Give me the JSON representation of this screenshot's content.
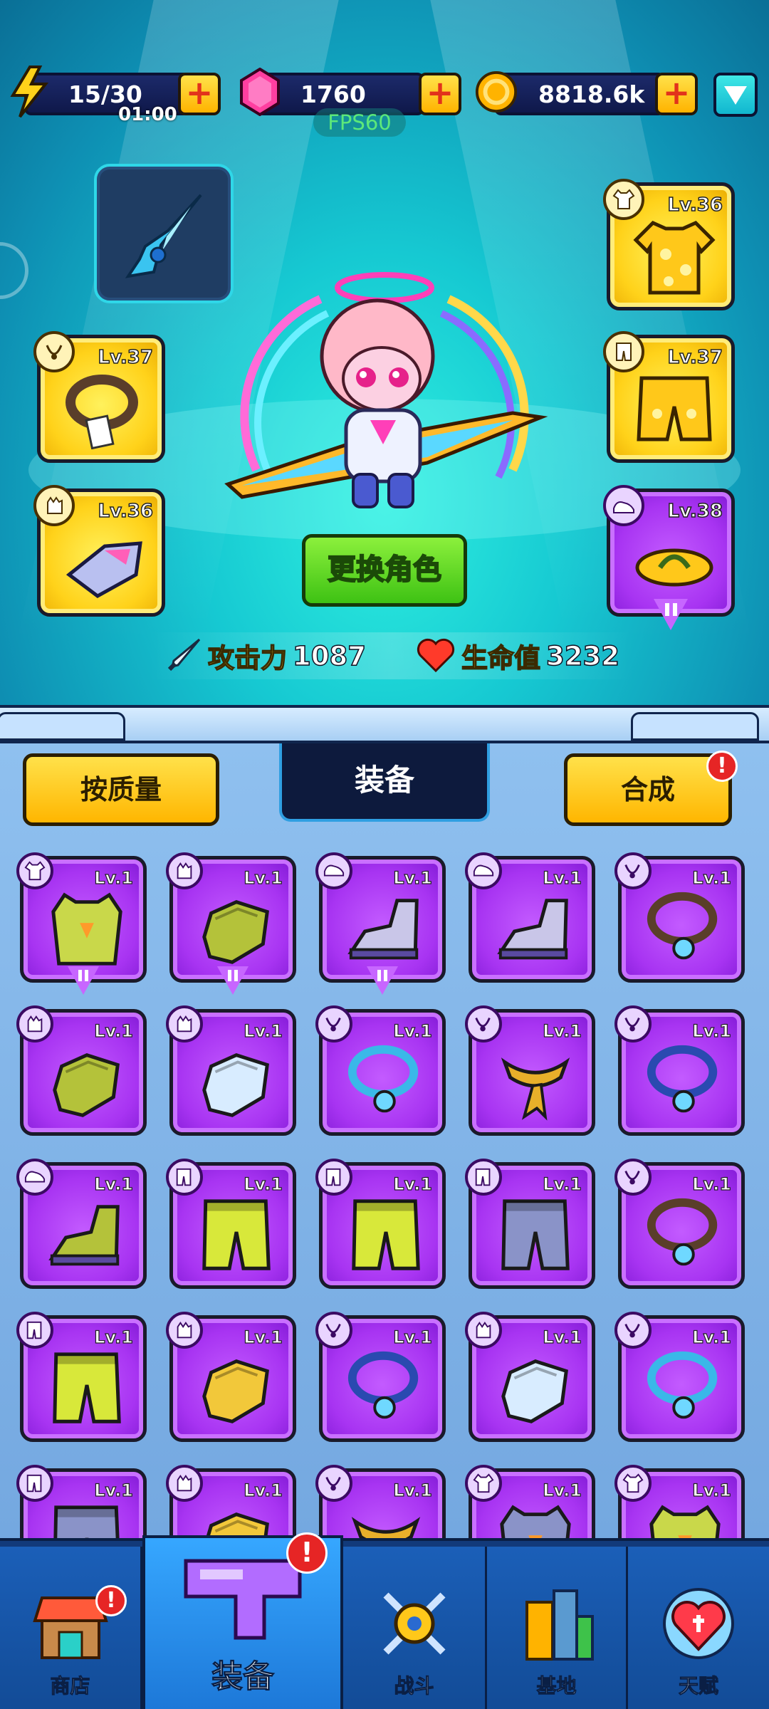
{
  "resources": {
    "energy": {
      "value": "15/30",
      "timer": "01:00"
    },
    "gems": {
      "value": "1760"
    },
    "coins": {
      "value": "8818.6k"
    }
  },
  "fps": "FPS60",
  "equipped": {
    "top": {
      "level": "Lv.36",
      "slot": "shirt-icon"
    },
    "left_mid": {
      "level": "Lv.37",
      "slot": "necklace-icon"
    },
    "right_mid": {
      "level": "Lv.37",
      "slot": "pants-icon"
    },
    "left_bottom": {
      "level": "Lv.36",
      "slot": "glove-icon"
    },
    "right_bottom": {
      "level": "Lv.38",
      "slot": "shoe-icon"
    }
  },
  "change_character_label": "更换角色",
  "stats": {
    "attack_label": "攻击力",
    "attack_value": "1087",
    "hp_label": "生命值",
    "hp_value": "3232"
  },
  "inventory": {
    "sort_label": "按质量",
    "tab_label": "装备",
    "merge_label": "合成",
    "merge_alert": "!",
    "items": [
      {
        "level": "Lv.1",
        "slot": "vest",
        "color": "#c9d84a",
        "merge": true
      },
      {
        "level": "Lv.1",
        "slot": "glove",
        "color": "#b4c23a",
        "merge": true
      },
      {
        "level": "Lv.1",
        "slot": "boot",
        "color": "#c9c6e8",
        "merge": true
      },
      {
        "level": "Lv.1",
        "slot": "boot",
        "color": "#c9c6e8",
        "merge": false
      },
      {
        "level": "Lv.1",
        "slot": "necklace",
        "color": "#5a3e2a",
        "merge": false
      },
      {
        "level": "Lv.1",
        "slot": "glove",
        "color": "#b4c23a",
        "merge": false
      },
      {
        "level": "Lv.1",
        "slot": "glove",
        "color": "#d8ecff",
        "merge": false
      },
      {
        "level": "Lv.1",
        "slot": "necklace",
        "color": "#3ab8e8",
        "merge": false
      },
      {
        "level": "Lv.1",
        "slot": "scarf",
        "color": "#e8b02a",
        "merge": false
      },
      {
        "level": "Lv.1",
        "slot": "necklace",
        "color": "#2a4ab0",
        "merge": false
      },
      {
        "level": "Lv.1",
        "slot": "boot",
        "color": "#b4c23a",
        "merge": false
      },
      {
        "level": "Lv.1",
        "slot": "pants",
        "color": "#d8e83a",
        "merge": false
      },
      {
        "level": "Lv.1",
        "slot": "pants",
        "color": "#d8e83a",
        "merge": false
      },
      {
        "level": "Lv.1",
        "slot": "pants",
        "color": "#8a93c8",
        "merge": false
      },
      {
        "level": "Lv.1",
        "slot": "necklace",
        "color": "#5a3e2a",
        "merge": false
      },
      {
        "level": "Lv.1",
        "slot": "pants",
        "color": "#d8e83a",
        "merge": false
      },
      {
        "level": "Lv.1",
        "slot": "glove",
        "color": "#f2c83a",
        "merge": false
      },
      {
        "level": "Lv.1",
        "slot": "necklace",
        "color": "#2a4ab0",
        "merge": false
      },
      {
        "level": "Lv.1",
        "slot": "glove",
        "color": "#d8ecff",
        "merge": false
      },
      {
        "level": "Lv.1",
        "slot": "necklace",
        "color": "#3ab8e8",
        "merge": false
      },
      {
        "level": "Lv.1",
        "slot": "pants",
        "color": "#8a93c8",
        "merge": false
      },
      {
        "level": "Lv.1",
        "slot": "glove",
        "color": "#f2c83a",
        "merge": false
      },
      {
        "level": "Lv.1",
        "slot": "scarf",
        "color": "#e8b02a",
        "merge": false
      },
      {
        "level": "Lv.1",
        "slot": "vest",
        "color": "#8a93c8",
        "merge": false
      },
      {
        "level": "Lv.1",
        "slot": "vest",
        "color": "#c9d84a",
        "merge": false
      }
    ]
  },
  "nav": {
    "shop": "商店",
    "equipment": "装备",
    "battle": "战斗",
    "base": "基地",
    "talent": "天赋",
    "shop_alert": "!",
    "equipment_alert": "!"
  }
}
